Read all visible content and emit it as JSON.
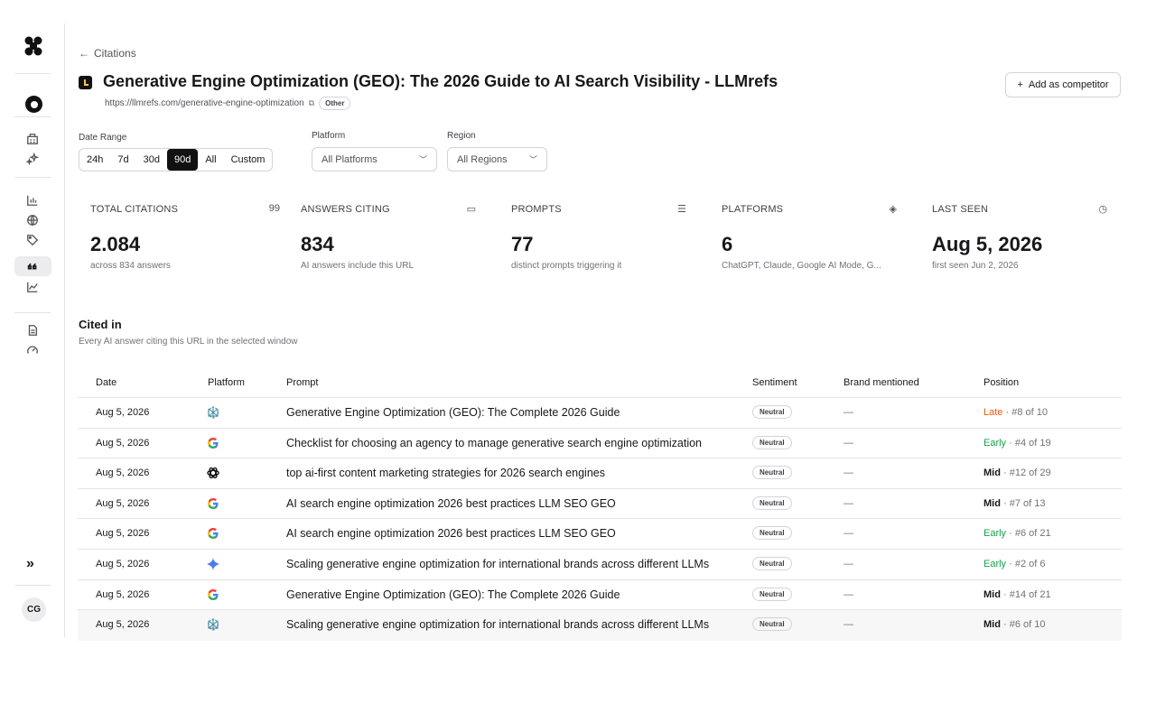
{
  "user": {
    "initials": "CG"
  },
  "header": {
    "back_label": "Citations",
    "title": "Generative Engine Optimization (GEO): The 2026 Guide to AI Search Visibility - LLMrefs",
    "url": "https://llmrefs.com/generative-engine-optimization",
    "tag": "Other",
    "add_button": "Add as competitor"
  },
  "filters": {
    "date_range_label": "Date Range",
    "date_options": [
      "24h",
      "7d",
      "30d",
      "90d",
      "All",
      "Custom"
    ],
    "date_selected": "90d",
    "platform_label": "Platform",
    "platform_value": "All Platforms",
    "region_label": "Region",
    "region_value": "All Regions"
  },
  "stats": [
    {
      "label": "TOTAL CITATIONS",
      "value": "2.084",
      "sub": "across 834 answers",
      "icon": "quote-icon"
    },
    {
      "label": "ANSWERS CITING",
      "value": "834",
      "sub": "AI answers include this URL",
      "icon": "chat-icon"
    },
    {
      "label": "PROMPTS",
      "value": "77",
      "sub": "distinct prompts triggering it",
      "icon": "list-check-icon"
    },
    {
      "label": "PLATFORMS",
      "value": "6",
      "sub": "ChatGPT, Claude, Google AI Mode, G...",
      "icon": "layers-icon"
    },
    {
      "label": "LAST SEEN",
      "value": "Aug 5, 2026",
      "sub": "first seen Jun 2, 2026",
      "icon": "clock-icon"
    }
  ],
  "cited": {
    "title": "Cited in",
    "subtitle": "Every AI answer citing this URL in the selected window"
  },
  "table": {
    "columns": [
      "Date",
      "Platform",
      "Prompt",
      "Sentiment",
      "Brand mentioned",
      "Position"
    ],
    "rows": [
      {
        "date": "Aug 5, 2026",
        "platform": "perplexity",
        "prompt": "Generative Engine Optimization (GEO): The Complete 2026 Guide",
        "sentiment": "Neutral",
        "brand": "—",
        "pos_label": "Late",
        "pos_rank": "· #8 of 10",
        "pos_kind": "late"
      },
      {
        "date": "Aug 5, 2026",
        "platform": "google",
        "prompt": "Checklist for choosing an agency to manage generative search engine optimization",
        "sentiment": "Neutral",
        "brand": "—",
        "pos_label": "Early",
        "pos_rank": "· #4 of 19",
        "pos_kind": "early"
      },
      {
        "date": "Aug 5, 2026",
        "platform": "chatgpt",
        "prompt": "top ai-first content marketing strategies for 2026 search engines",
        "sentiment": "Neutral",
        "brand": "—",
        "pos_label": "Mid",
        "pos_rank": "· #12 of 29",
        "pos_kind": "mid"
      },
      {
        "date": "Aug 5, 2026",
        "platform": "google",
        "prompt": "AI search engine optimization 2026 best practices LLM SEO GEO",
        "sentiment": "Neutral",
        "brand": "—",
        "pos_label": "Mid",
        "pos_rank": "· #7 of 13",
        "pos_kind": "mid"
      },
      {
        "date": "Aug 5, 2026",
        "platform": "google",
        "prompt": "AI search engine optimization 2026 best practices LLM SEO GEO",
        "sentiment": "Neutral",
        "brand": "—",
        "pos_label": "Early",
        "pos_rank": "· #6 of 21",
        "pos_kind": "early"
      },
      {
        "date": "Aug 5, 2026",
        "platform": "gemini",
        "prompt": "Scaling generative engine optimization for international brands across different LLMs",
        "sentiment": "Neutral",
        "brand": "—",
        "pos_label": "Early",
        "pos_rank": "· #2 of 6",
        "pos_kind": "early"
      },
      {
        "date": "Aug 5, 2026",
        "platform": "google",
        "prompt": "Generative Engine Optimization (GEO): The Complete 2026 Guide",
        "sentiment": "Neutral",
        "brand": "—",
        "pos_label": "Mid",
        "pos_rank": "· #14 of 21",
        "pos_kind": "mid"
      },
      {
        "date": "Aug 5, 2026",
        "platform": "perplexity",
        "prompt": "Scaling generative engine optimization for international brands across different LLMs",
        "sentiment": "Neutral",
        "brand": "—",
        "pos_label": "Mid",
        "pos_rank": "· #6 of 10",
        "pos_kind": "mid"
      }
    ]
  }
}
